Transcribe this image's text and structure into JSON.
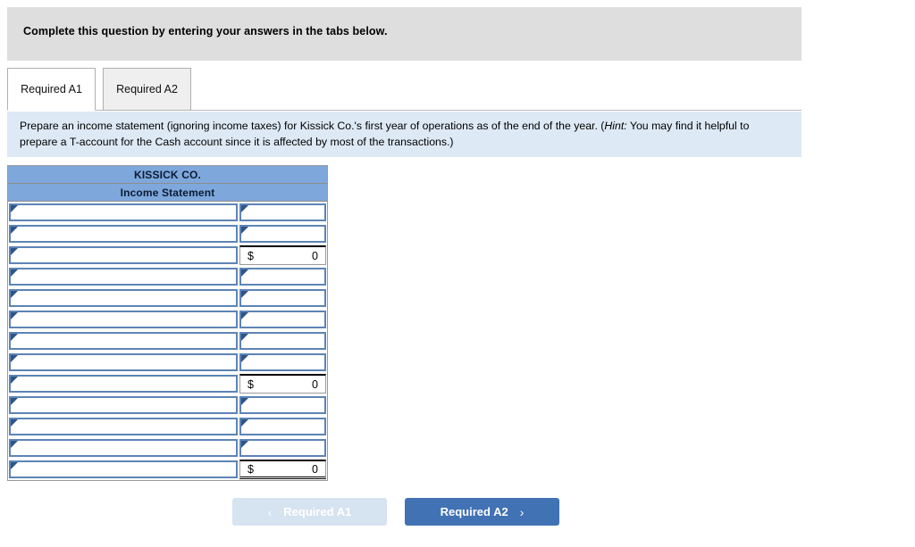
{
  "banner": {
    "text": "Complete this question by entering your answers in the tabs below."
  },
  "tabs": [
    {
      "label": "Required A1",
      "active": true
    },
    {
      "label": "Required A2",
      "active": false
    }
  ],
  "instruction": {
    "part1": "Prepare an income statement (ignoring income taxes) for Kissick Co.'s first year of operations as of the end of the year. (",
    "hint_word": "Hint:",
    "part2": " You may find it helpful to prepare a T-account for the Cash account since it is affected by most of the transactions.)"
  },
  "sheet": {
    "title": "KISSICK CO.",
    "subtitle": "Income Statement",
    "currency_symbol": "$",
    "zero_value": "0",
    "rows": [
      {
        "type": "input",
        "label_value": "",
        "amount_value": ""
      },
      {
        "type": "input",
        "label_value": "",
        "amount_value": ""
      },
      {
        "type": "total",
        "label_value": "",
        "currency": "$",
        "amount": "0"
      },
      {
        "type": "input",
        "label_value": "",
        "amount_value": ""
      },
      {
        "type": "input",
        "label_value": "",
        "amount_value": ""
      },
      {
        "type": "input",
        "label_value": "",
        "amount_value": ""
      },
      {
        "type": "input",
        "label_value": "",
        "amount_value": ""
      },
      {
        "type": "input",
        "label_value": "",
        "amount_value": ""
      },
      {
        "type": "total",
        "label_value": "",
        "currency": "$",
        "amount": "0"
      },
      {
        "type": "input",
        "label_value": "",
        "amount_value": ""
      },
      {
        "type": "input",
        "label_value": "",
        "amount_value": ""
      },
      {
        "type": "input",
        "label_value": "",
        "amount_value": ""
      },
      {
        "type": "grand",
        "label_value": "",
        "currency": "$",
        "amount": "0"
      }
    ]
  },
  "navigation": {
    "prev": {
      "label": "Required A1",
      "icon": "chevron-left-icon",
      "glyph": "‹",
      "disabled": true
    },
    "next": {
      "label": "Required A2",
      "icon": "chevron-right-icon",
      "glyph": "›",
      "disabled": false
    }
  },
  "colors": {
    "banner_bg": "#dedede",
    "instruction_bg": "#dde9f5",
    "sheet_header_bg": "#7ea8dc",
    "input_border": "#5d84b6",
    "marker": "#2f5488",
    "next_button_bg": "#4172b4",
    "prev_button_bg": "#d6e3f1"
  }
}
